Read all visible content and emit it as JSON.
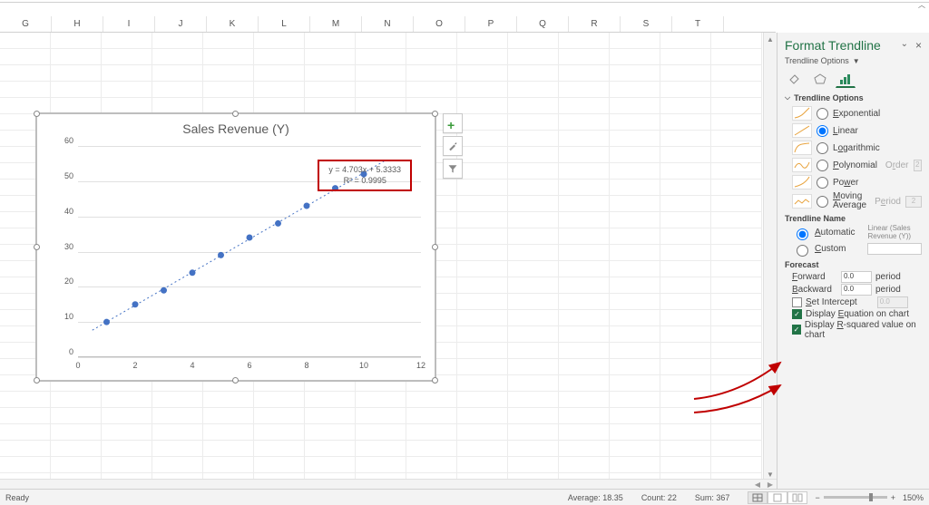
{
  "columns": [
    "G",
    "H",
    "I",
    "J",
    "K",
    "L",
    "M",
    "N",
    "O",
    "P",
    "Q",
    "R",
    "S",
    "T"
  ],
  "chart_data": {
    "type": "scatter",
    "title": "Sales Revenue (Y)",
    "x": [
      1,
      2,
      3,
      4,
      5,
      6,
      7,
      8,
      9,
      10
    ],
    "y": [
      10,
      15,
      19,
      24,
      29,
      34,
      38,
      43,
      48,
      52
    ],
    "xlim": [
      0,
      12
    ],
    "ylim": [
      0,
      60
    ],
    "xticks": [
      0,
      2,
      4,
      6,
      8,
      10,
      12
    ],
    "yticks": [
      0,
      10,
      20,
      30,
      40,
      50,
      60
    ],
    "trendline": {
      "slope": 4.703,
      "intercept": 5.3333
    },
    "equation": "y = 4.703x + 5.3333",
    "r2": "R² = 0.9995"
  },
  "chart_buttons": {
    "plus": "+",
    "brush": "✎",
    "filter": "▼"
  },
  "panel": {
    "title": "Format Trendline",
    "sub": "Trendline Options",
    "section": "Trendline Options",
    "types": {
      "exp": "Exponential",
      "lin": "Linear",
      "log": "Logarithmic",
      "poly": "Polynomial",
      "power": "Power",
      "mavg": "Moving Average"
    },
    "order_label": "Order",
    "order_value": "2",
    "period_label": "Period",
    "period_value": "2",
    "name_head": "Trendline Name",
    "auto": "Automatic",
    "auto_name": "Linear (Sales Revenue (Y))",
    "custom": "Custom",
    "forecast_head": "Forecast",
    "forward": "Forward",
    "backward": "Backward",
    "period_unit": "period",
    "fwd_value": "0.0",
    "bwd_value": "0.0",
    "set_intercept": "Set Intercept",
    "intercept_value": "0.0",
    "eq": "Display Equation on chart",
    "r2_label": "Display R-squared value on chart"
  },
  "status": {
    "ready": "Ready",
    "avg_label": "Average:",
    "avg_value": "18.35",
    "count_label": "Count:",
    "count_value": "22",
    "sum_label": "Sum:",
    "sum_value": "367",
    "zoom": "150%"
  }
}
